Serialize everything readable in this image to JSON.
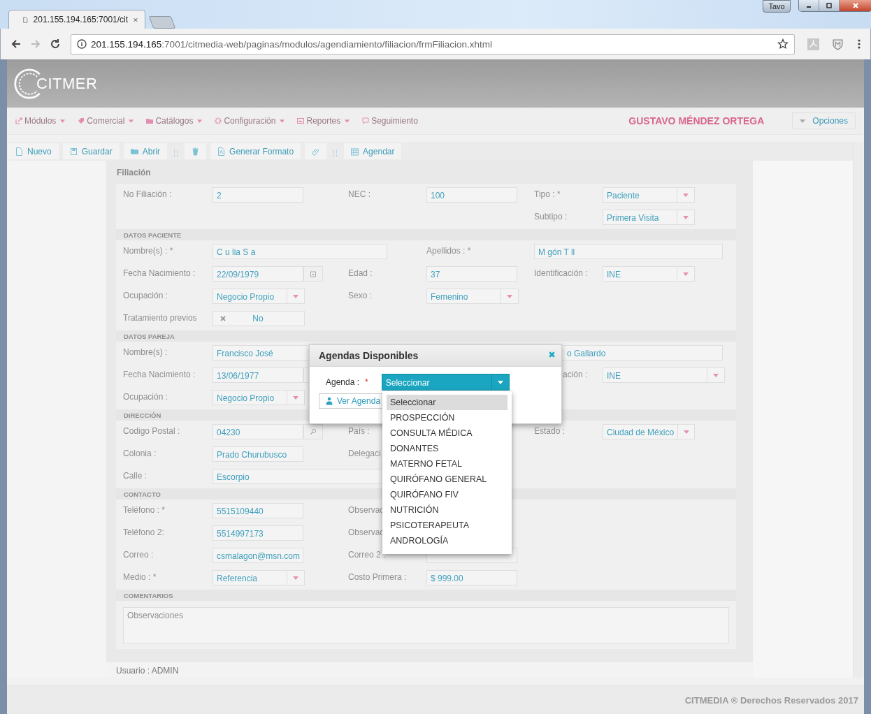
{
  "browser": {
    "tab_title": "201.155.194.165:7001/cit",
    "url_host": "201.155.194.165",
    "url_path": ":7001/citmedia-web/paginas/modulos/agendiamiento/filiacion/frmFiliacion.xhtml",
    "profile": "Tavo"
  },
  "app": {
    "logo": "CITMER",
    "menu": [
      {
        "label": "Módulos",
        "caret": true
      },
      {
        "label": "Comercial",
        "caret": true
      },
      {
        "label": "Catálogos",
        "caret": true
      },
      {
        "label": "Configuración",
        "caret": true
      },
      {
        "label": "Reportes",
        "caret": true
      },
      {
        "label": "Seguimiento",
        "caret": false
      }
    ],
    "user_name": "GUSTAVO MÉNDEZ ORTEGA",
    "options_button": "Opciones",
    "toolbar": [
      {
        "kind": "button",
        "label": "Nuevo"
      },
      {
        "kind": "button",
        "label": "Guardar"
      },
      {
        "kind": "button",
        "label": "Abrir"
      },
      {
        "kind": "separator"
      },
      {
        "kind": "icon_button"
      },
      {
        "kind": "button",
        "label": "Generar Formato"
      },
      {
        "kind": "icon_button"
      },
      {
        "kind": "separator"
      },
      {
        "kind": "button",
        "label": "Agendar"
      }
    ]
  },
  "form": {
    "title": "Filiación",
    "sections": [
      {
        "rows": [
          {
            "left": {
              "label": "No Filiación :",
              "kind": "text",
              "value": "2"
            },
            "middle": {
              "label": "NEC :",
              "kind": "text",
              "value": "100"
            },
            "right": {
              "label": "Tipo : *",
              "kind": "select",
              "value": "Paciente"
            }
          },
          {
            "right": {
              "label": "Subtipo :",
              "kind": "select",
              "value": "Primera Visita"
            }
          }
        ]
      },
      {
        "heading": "DATOS PACIENTE",
        "rows": [
          {
            "kind": "names",
            "left": {
              "label": "Nombre(s) : *",
              "kind": "text",
              "value": "C  u lia S  a"
            },
            "right": {
              "label": "Apellidos : *",
              "kind": "text",
              "value": "M  gón T  ll"
            }
          },
          {
            "left": {
              "label": "Fecha Nacimiento :",
              "kind": "date",
              "value": "22/09/1979"
            },
            "middle": {
              "label": "Edad :",
              "kind": "text",
              "value": "37"
            },
            "right": {
              "label": "Identificación :",
              "kind": "select",
              "value": "INE"
            }
          },
          {
            "left": {
              "label": "Ocupación :",
              "kind": "select",
              "value": "Negocio Propio"
            },
            "middle": {
              "label": "Sexo :",
              "kind": "select",
              "value": "Femenino"
            }
          },
          {
            "left": {
              "label": "Tratamiento previos",
              "kind": "toggle",
              "on": false,
              "value": "No"
            }
          }
        ]
      },
      {
        "heading": "DATOS PAREJA",
        "rows": [
          {
            "kind": "names",
            "left": {
              "label": "Nombre(s) :",
              "kind": "text",
              "value": "Francisco José"
            },
            "right": {
              "kind": "text",
              "value": "o Gallardo",
              "covered": true
            }
          },
          {
            "left": {
              "label": "Fecha Nacimiento :",
              "kind": "date",
              "value": "13/06/1977"
            },
            "right": {
              "label": "ación :",
              "kind": "select",
              "value": "INE",
              "covered": true
            }
          },
          {
            "left": {
              "label": "Ocupación :",
              "kind": "select",
              "value": "Negocio Propio"
            }
          }
        ]
      },
      {
        "heading": "DIRECCIÓN",
        "rows": [
          {
            "left": {
              "label": "Codigo Postal :",
              "kind": "search",
              "value": "04230"
            },
            "middle": {
              "label": "País :",
              "kind": "label"
            },
            "right": {
              "label": "Estado :",
              "kind": "select",
              "value": "Ciudad de México"
            }
          },
          {
            "left": {
              "label": "Colonia :",
              "kind": "text",
              "value": "Prado Churubusco"
            },
            "middle": {
              "label": "Delegaci",
              "kind": "label"
            }
          },
          {
            "left": {
              "label": "Calle :",
              "kind": "wide",
              "value": "Escorpio"
            }
          }
        ]
      },
      {
        "heading": "CONTACTO",
        "rows": [
          {
            "left": {
              "label": "Teléfono : *",
              "kind": "text",
              "value": "5515109440"
            },
            "middle": {
              "label": "Observac",
              "kind": "label"
            }
          },
          {
            "left": {
              "label": "Teléfono 2:",
              "kind": "text",
              "value": "5514997173"
            },
            "middle": {
              "label": "Observac",
              "kind": "label"
            }
          },
          {
            "left": {
              "label": "Correo :",
              "kind": "text",
              "value": "csmalagon@msn.com"
            },
            "middle": {
              "label": "Correo 2 :",
              "kind": "text"
            }
          },
          {
            "left": {
              "label": "Medio : *",
              "kind": "select",
              "value": "Referencia"
            },
            "middle": {
              "label": "Costo Primera :",
              "kind": "text",
              "value": "$ 999.00"
            }
          }
        ]
      },
      {
        "heading": "COMENTARIOS",
        "textarea": {
          "placeholder": "Observaciones"
        }
      }
    ]
  },
  "status": "Usuario : ADMIN",
  "footer": "CITMEDIA ® Derechos Reservados 2017",
  "dialog": {
    "title": "Agendas Disponibles",
    "field_label": "Agenda :",
    "required_mark": "*",
    "select_value": "Seleccionar",
    "button": "Ver Agenda",
    "options": [
      {
        "label": "Seleccionar",
        "selected": true
      },
      {
        "label": "PROSPECCIÓN",
        "selected": false
      },
      {
        "label": "CONSULTA MÉDICA",
        "selected": false
      },
      {
        "label": "DONANTES",
        "selected": false
      },
      {
        "label": "MATERNO FETAL",
        "selected": false
      },
      {
        "label": "QUIRÓFANO GENERAL",
        "selected": false
      },
      {
        "label": "QUIRÓFANO FIV",
        "selected": false
      },
      {
        "label": "NUTRICIÓN",
        "selected": false
      },
      {
        "label": "PSICOTERAPEUTA",
        "selected": false
      },
      {
        "label": "ANDROLOGÍA",
        "selected": false
      }
    ]
  }
}
